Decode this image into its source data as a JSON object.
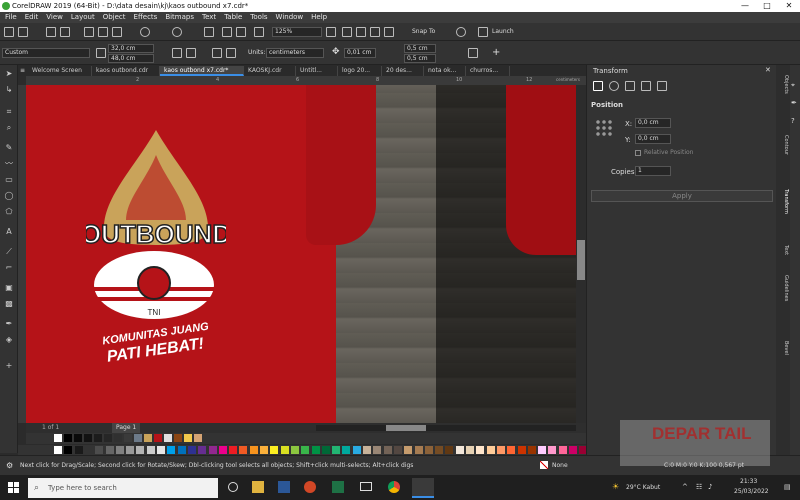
{
  "window": {
    "title": "CorelDRAW 2019 (64-Bit) - D:\\data desain\\kj\\kaos outbound x7.cdr*",
    "min": "—",
    "max": "□",
    "close": "✕"
  },
  "menu": [
    "File",
    "Edit",
    "View",
    "Layout",
    "Object",
    "Effects",
    "Bitmaps",
    "Text",
    "Table",
    "Tools",
    "Window",
    "Help"
  ],
  "standard_toolbar": {
    "zoom": "125%",
    "snap": "Snap To",
    "launch": "Launch"
  },
  "property_bar": {
    "preset": "Custom",
    "width": "32,0 cm",
    "height": "48,0 cm",
    "units_label": "Units:",
    "units": "centimeters",
    "nudge": "0,01 cm",
    "dup_x": "0,5 cm",
    "dup_y": "0,5 cm"
  },
  "tabs": [
    {
      "label": "Welcome Screen",
      "active": false
    },
    {
      "label": "kaos outbond.cdr",
      "active": false
    },
    {
      "label": "kaos outbond x7.cdr*",
      "active": true
    },
    {
      "label": "KAOSKJ.cdr",
      "active": false
    },
    {
      "label": "Untitl...",
      "active": false
    },
    {
      "label": "logo 20...",
      "active": false
    },
    {
      "label": "20 des...",
      "active": false
    },
    {
      "label": "nota ok...",
      "active": false
    },
    {
      "label": "churros...",
      "active": false
    }
  ],
  "ruler": {
    "unit": "centimeters",
    "ticks": [
      "2",
      "4",
      "6",
      "8",
      "10",
      "12"
    ]
  },
  "artwork": {
    "title": "OUTBOUND",
    "tagline_1": "KOMUNITAS JUANG",
    "tagline_2": "PATI HEBAT!",
    "badge": "TNI"
  },
  "page_nav": {
    "page": "Page 1",
    "pos": "1 of 1"
  },
  "docker": {
    "title": "Transform",
    "section": "Position",
    "x_label": "X:",
    "x_value": "0,0 cm",
    "y_label": "Y:",
    "y_value": "0,0 cm",
    "relative": "Relative Position",
    "copies_label": "Copies:",
    "copies_value": "1",
    "apply": "Apply"
  },
  "docker_tabs": [
    "Objects",
    "Contour",
    "Transform",
    "Text",
    "Guidelines",
    "Bevel"
  ],
  "status": {
    "hint": "Next click for Drag/Scale; Second click for Rotate/Skew; Dbl-clicking tool selects all objects; Shift+click multi-selects; Alt+click digs",
    "fill": "None",
    "outline": "C:0 M:0 Y:0 K:100  0,567 pt"
  },
  "taskbar": {
    "search": "Type here to search",
    "weather": "29°C  Kabut",
    "time": "21:33",
    "date": "25/03/2022"
  },
  "watermark": "DEPAR TAIL",
  "colors": {
    "accent": "#3a8ee6",
    "shirt": "#b51318",
    "gold": "#c9a35a"
  },
  "palette_colors": [
    "#ffffff",
    "#000000",
    "#1a1a1a",
    "#333333",
    "#4d4d4d",
    "#666666",
    "#808080",
    "#999999",
    "#b3b3b3",
    "#cccccc",
    "#e6e6e6",
    "#00a0e9",
    "#0071bc",
    "#2e3192",
    "#662d91",
    "#92278f",
    "#ec008c",
    "#ed1c24",
    "#f15a24",
    "#f7931e",
    "#fbb03b",
    "#fcee21",
    "#d9e021",
    "#8cc63f",
    "#39b54a",
    "#009245",
    "#006837",
    "#22b573",
    "#00a99d",
    "#29abe2",
    "#c7b299",
    "#998675",
    "#736357",
    "#534741",
    "#c69c6d",
    "#a67c52",
    "#8c6239",
    "#754c24",
    "#603813",
    "#f2e6d9",
    "#e6d1b3",
    "#ffe6cc",
    "#ffcc99",
    "#ff9966",
    "#ff6633",
    "#cc3300",
    "#993300",
    "#ffccff",
    "#ff99cc",
    "#ff6699",
    "#cc0066",
    "#990033",
    "#ccffcc",
    "#99ff99",
    "#66cc66",
    "#339933",
    "#006600",
    "#ccffff",
    "#99ccff",
    "#6699ff",
    "#3366cc",
    "#003399",
    "#e8e8d0",
    "#d0d0a0",
    "#b0b070",
    "#909050",
    "#707030",
    "#c0c0ff",
    "#a0a0e0",
    "#8080c0"
  ],
  "doc_palette_colors": [
    "#ffffff",
    "#000000",
    "#0a0a0a",
    "#121212",
    "#1c1c1c",
    "#262626",
    "#303030",
    "#3a3a3a",
    "#6c7a89",
    "#c9a35a",
    "#b51318",
    "#e0e0e0",
    "#8b4513",
    "#f2c94c",
    "#d4a373"
  ]
}
